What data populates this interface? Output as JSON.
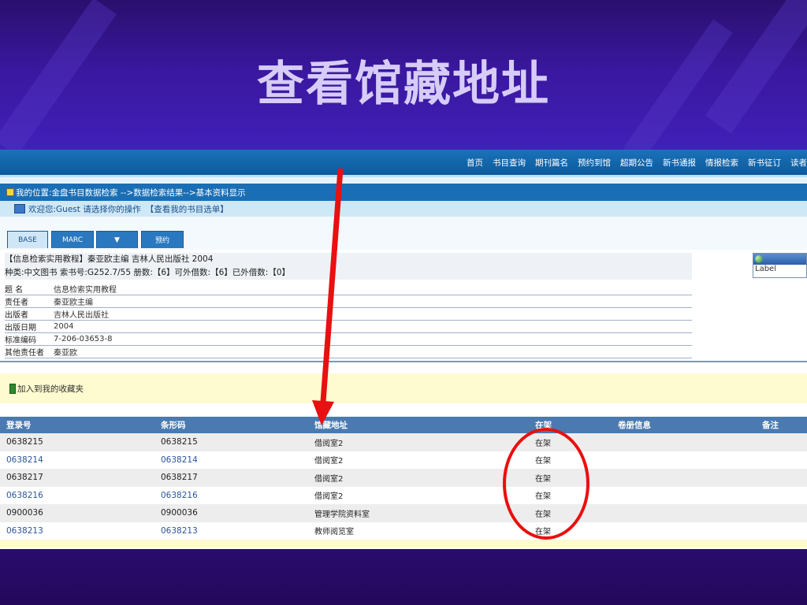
{
  "slide": {
    "title": "查看馆藏地址"
  },
  "nav": {
    "items": [
      "首页",
      "书目查询",
      "期刊篇名",
      "预约到馆",
      "超期公告",
      "新书通报",
      "情报检索",
      "新书征订",
      "读者"
    ]
  },
  "breadcrumb": "我的位置:金盘书目数据检索 -->数据检索结果-->基本资料显示",
  "welcome": {
    "text": "欢迎您:Guest 请选择你的操作",
    "link": "【查看我的书目选单】"
  },
  "tabs": [
    "BASE",
    "MARC",
    "▼",
    "预约"
  ],
  "book": {
    "header": "【信息检索实用教程】秦亚欧主编 吉林人民出版社 2004",
    "call_line": "种类:中文图书 索书号:G252.7/55   册数:【6】可外借数:【6】已外借数:【0】",
    "fields": [
      {
        "label": "题  名",
        "value": "信息检索实用教程"
      },
      {
        "label": "责任者",
        "value": "秦亚欧主编"
      },
      {
        "label": "出版者",
        "value": "吉林人民出版社"
      },
      {
        "label": "出版日期",
        "value": "2004"
      },
      {
        "label": "标准编码",
        "value": "7-206-03653-8"
      },
      {
        "label": "其他责任者",
        "value": "秦亚欧"
      }
    ]
  },
  "label_widget": {
    "text": "Label"
  },
  "favorites": {
    "text": "加入到我的收藏夹"
  },
  "holdings": {
    "columns": [
      "登录号",
      "条形码",
      "馆藏地址",
      "在架",
      "卷册信息",
      "备注"
    ],
    "rows": [
      [
        "0638215",
        "0638215",
        "借阅室2",
        "在架",
        "",
        ""
      ],
      [
        "0638214",
        "0638214",
        "借阅室2",
        "在架",
        "",
        ""
      ],
      [
        "0638217",
        "0638217",
        "借阅室2",
        "在架",
        "",
        ""
      ],
      [
        "0638216",
        "0638216",
        "借阅室2",
        "在架",
        "",
        ""
      ],
      [
        "0900036",
        "0900036",
        "管理学院资料室",
        "在架",
        "",
        ""
      ],
      [
        "0638213",
        "0638213",
        "教师阅览室",
        "在架",
        "",
        ""
      ]
    ]
  },
  "colors": {
    "annotation": "#e81010",
    "header_blue": "#1a6eb5",
    "slide_title": "#d6ccf7"
  }
}
